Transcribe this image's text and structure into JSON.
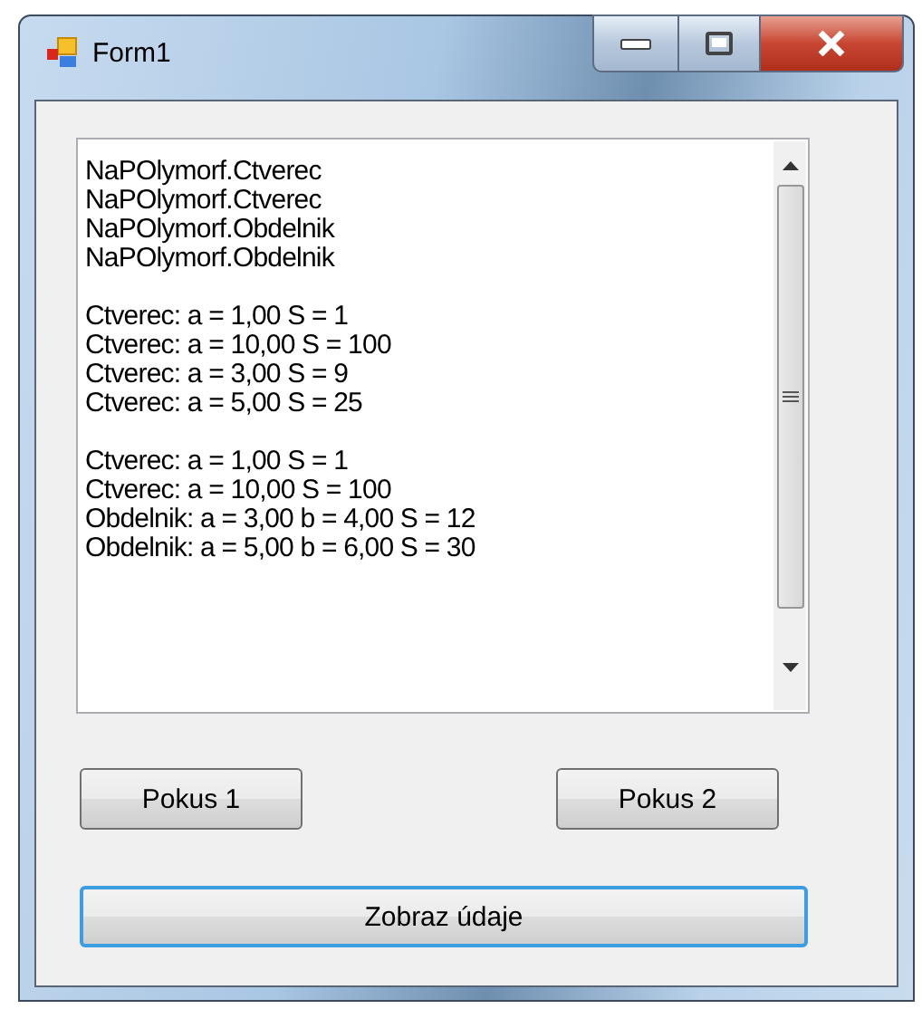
{
  "window": {
    "title": "Form1"
  },
  "listbox": {
    "groups": [
      [
        "NaPOlymorf.Ctverec",
        "NaPOlymorf.Ctverec",
        "NaPOlymorf.Obdelnik",
        "NaPOlymorf.Obdelnik"
      ],
      [
        "Ctverec: a = 1,00 S = 1",
        "Ctverec: a = 10,00 S = 100",
        "Ctverec: a = 3,00 S = 9",
        "Ctverec: a = 5,00 S = 25"
      ],
      [
        "Ctverec: a = 1,00 S = 1",
        "Ctverec: a = 10,00 S = 100",
        "Obdelnik: a = 3,00 b = 4,00 S = 12",
        "Obdelnik: a = 5,00 b = 6,00 S = 30"
      ]
    ]
  },
  "buttons": [
    {
      "label": "Pokus 1",
      "focused": false
    },
    {
      "label": "Pokus 2",
      "focused": false
    },
    {
      "label": "Zobraz údaje",
      "focused": true
    }
  ]
}
